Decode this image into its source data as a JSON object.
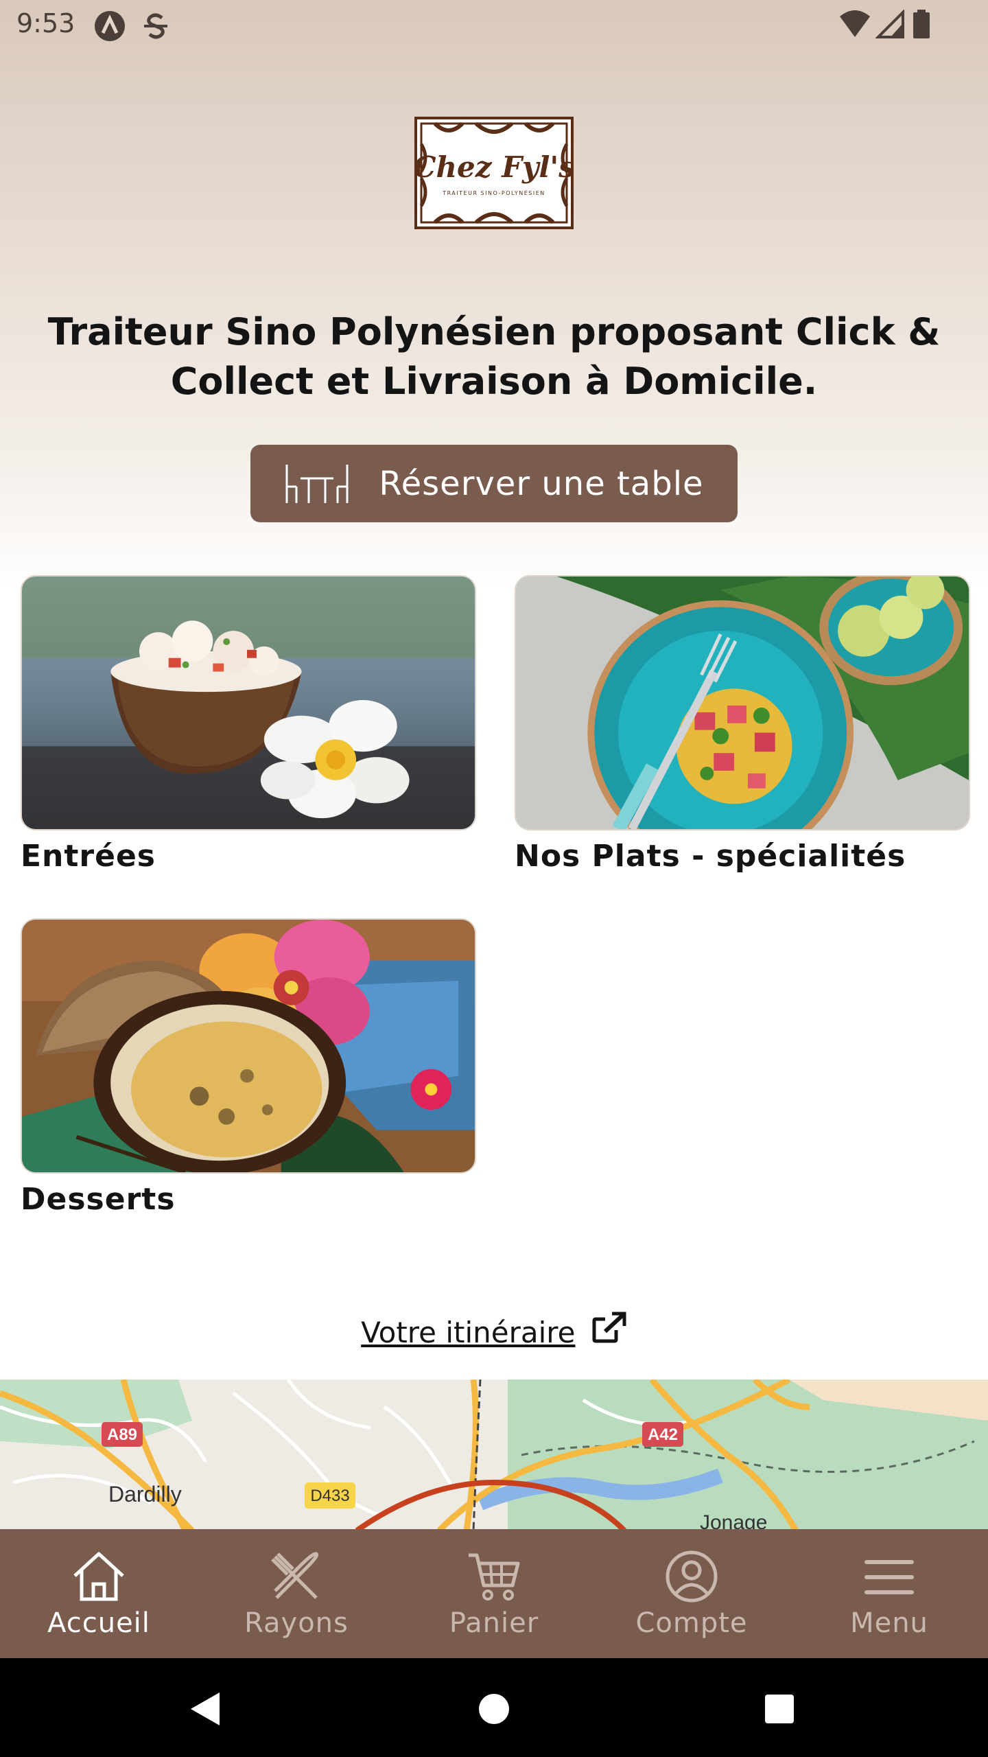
{
  "status": {
    "time": "9:53"
  },
  "brand": {
    "logo_text": "Chez Fyl's",
    "logo_subtitle": "TRAITEUR SINO-POLYNÉSIEN"
  },
  "headline": "Traiteur Sino Polynésien proposant Click & Collect et Livraison à Domicile.",
  "reserve_button": {
    "label": "Réserver une table",
    "icon": "table-chairs-icon"
  },
  "categories": [
    {
      "label": "Entrées",
      "image": "coconut-ceviche-flower-photo"
    },
    {
      "label": "Nos Plats - spécialités",
      "image": "tuna-tartare-turquoise-plate-photo"
    },
    {
      "label": "Desserts",
      "image": "coconut-creme-brulee-hibiscus-photo"
    }
  ],
  "itinerary": {
    "label": "Votre itinéraire",
    "icon": "external-link-icon"
  },
  "map": {
    "labels": [
      "A89",
      "Dardilly",
      "D433",
      "A42",
      "Jonage"
    ]
  },
  "bottom_nav": [
    {
      "label": "Accueil",
      "icon": "home-icon",
      "active": true
    },
    {
      "label": "Rayons",
      "icon": "utensils-icon",
      "active": false
    },
    {
      "label": "Panier",
      "icon": "cart-icon",
      "active": false
    },
    {
      "label": "Compte",
      "icon": "account-icon",
      "active": false
    },
    {
      "label": "Menu",
      "icon": "hamburger-icon",
      "active": false
    }
  ],
  "colors": {
    "brand_brown": "#7a5c4f",
    "logo_brown": "#5a2d16",
    "map_green": "#a8d5b0"
  }
}
